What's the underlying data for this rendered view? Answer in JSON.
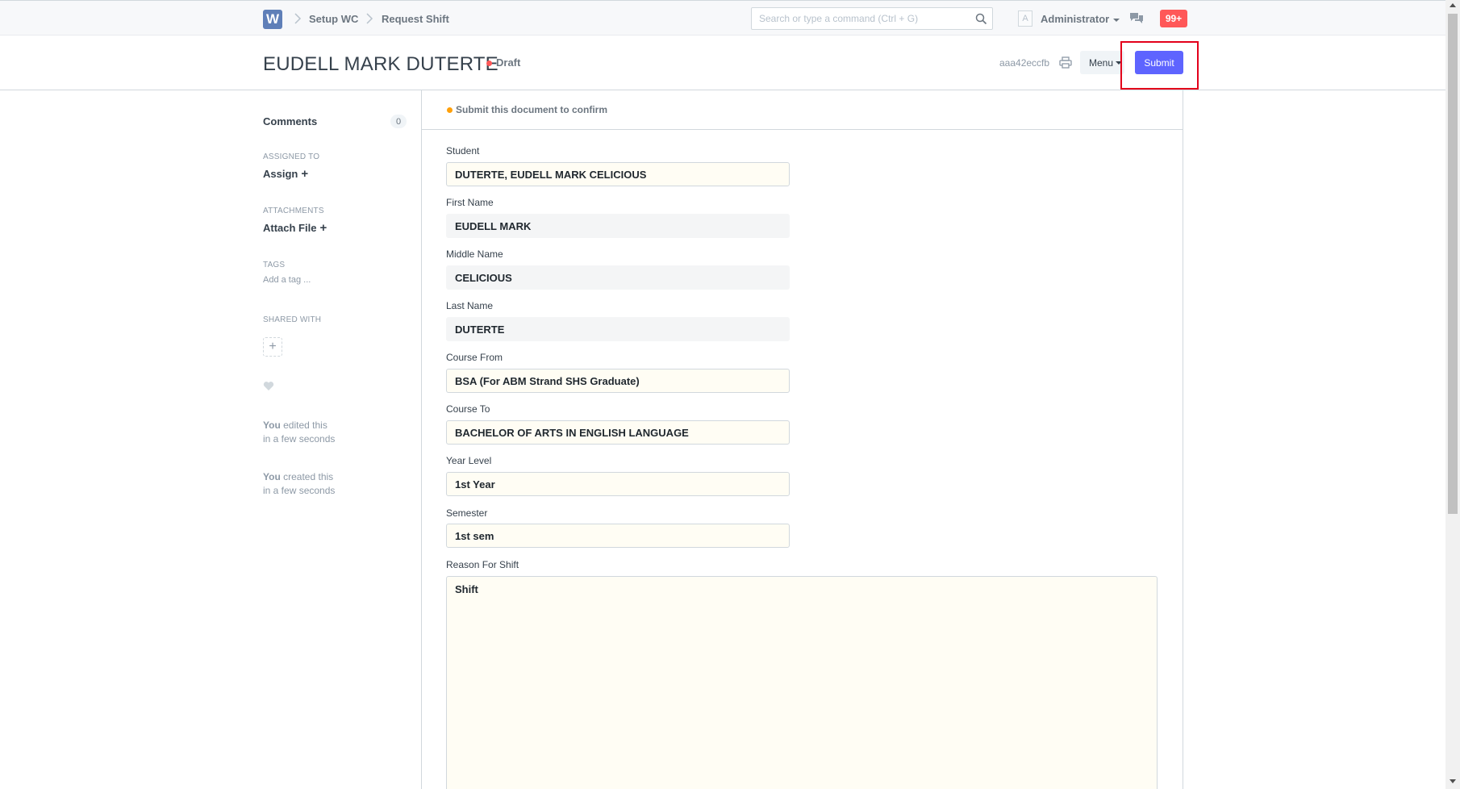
{
  "navbar": {
    "logo_letter": "W",
    "breadcrumbs": [
      "Setup WC",
      "Request Shift"
    ],
    "search_placeholder": "Search or type a command (Ctrl + G)",
    "avatar_letter": "A",
    "user_name": "Administrator",
    "notification_count": "99+"
  },
  "page_head": {
    "title": "EUDELL MARK DUTERTE",
    "status": "Draft",
    "doc_id": "aaa42eccfb",
    "menu_label": "Menu",
    "submit_label": "Submit"
  },
  "sidebar": {
    "comments_label": "Comments",
    "comments_count": "0",
    "assigned_heading": "ASSIGNED TO",
    "assign_label": "Assign",
    "attachments_heading": "ATTACHMENTS",
    "attach_label": "Attach File",
    "tags_heading": "TAGS",
    "tag_placeholder": "Add a tag ...",
    "shared_heading": "SHARED WITH",
    "timeline": [
      {
        "who": "You",
        "action": "edited this",
        "when": "in a few seconds"
      },
      {
        "who": "You",
        "action": "created this",
        "when": "in a few seconds"
      }
    ]
  },
  "form": {
    "message": "Submit this document to confirm",
    "fields": [
      {
        "label": "Student",
        "value": "DUTERTE, EUDELL MARK CELICIOUS"
      },
      {
        "label": "First Name",
        "value": "EUDELL MARK"
      },
      {
        "label": "Middle Name",
        "value": "CELICIOUS"
      },
      {
        "label": "Last Name",
        "value": "DUTERTE"
      },
      {
        "label": "Course From",
        "value": "BSA (For ABM Strand SHS Graduate)"
      },
      {
        "label": "Course To",
        "value": "BACHELOR OF ARTS IN ENGLISH LANGUAGE"
      },
      {
        "label": "Year Level",
        "value": "1st Year"
      },
      {
        "label": "Semester",
        "value": "1st sem"
      }
    ],
    "reason_label": "Reason For Shift",
    "reason_value": "Shift"
  },
  "colors": {
    "primary": "#5e64ff",
    "draft_indicator": "#ff5858",
    "notification": "#ff5858",
    "message_indicator": "#ffa00a",
    "highlight": "#e3001b"
  }
}
